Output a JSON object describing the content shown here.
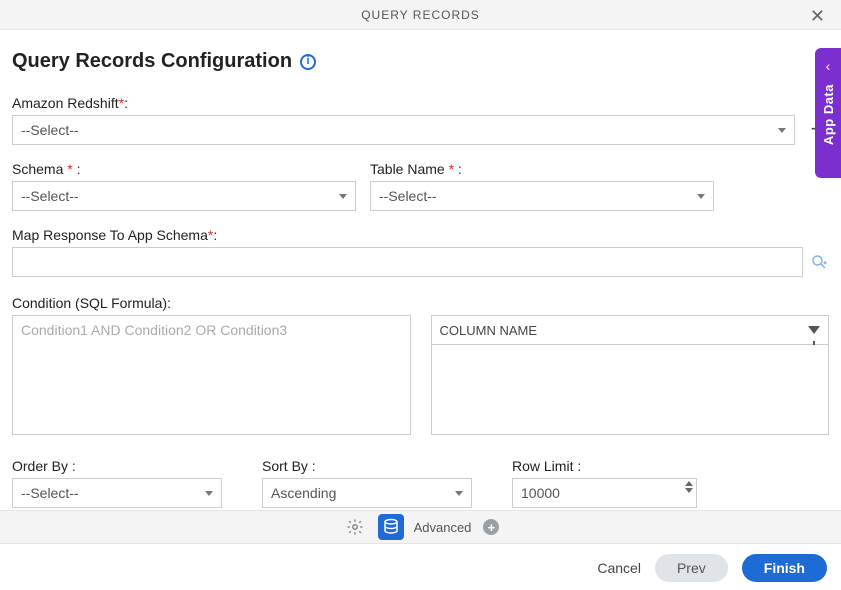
{
  "header": {
    "title": "QUERY RECORDS"
  },
  "page": {
    "title": "Query Records Configuration"
  },
  "sidebar": {
    "label": "App Data"
  },
  "fields": {
    "redshift": {
      "label": "Amazon Redshift",
      "selected": "--Select--"
    },
    "schema": {
      "label": "Schema",
      "colon": " :",
      "selected": "--Select--"
    },
    "table": {
      "label": "Table Name",
      "colon": " :",
      "selected": "--Select--"
    },
    "map": {
      "label": "Map Response To App Schema",
      "value": ""
    },
    "condition": {
      "label": "Condition (SQL Formula):",
      "placeholder": "Condition1 AND Condition2 OR Condition3"
    },
    "columnHeader": {
      "label": "COLUMN NAME"
    },
    "orderBy": {
      "label": "Order By :",
      "selected": "--Select--"
    },
    "sortBy": {
      "label": "Sort By :",
      "selected": "Ascending"
    },
    "rowLimit": {
      "label": "Row Limit :",
      "value": "10000"
    }
  },
  "toolbar": {
    "advanced": "Advanced"
  },
  "footer": {
    "cancel": "Cancel",
    "prev": "Prev",
    "finish": "Finish"
  }
}
